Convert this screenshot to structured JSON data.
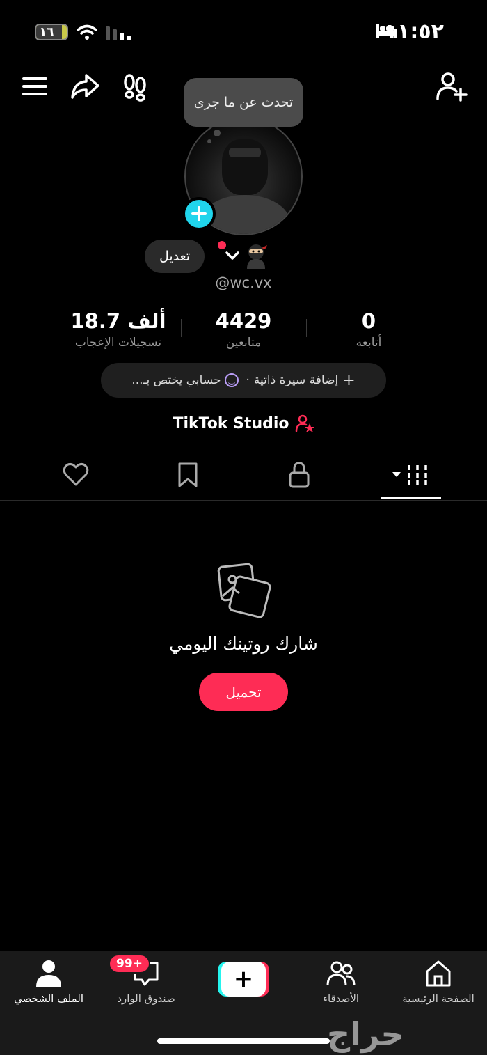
{
  "status_bar": {
    "time": "١١:٥٢",
    "battery_text": "١٦",
    "battery_level": 0.16
  },
  "bubble_text": "تحدث عن ما جرى",
  "profile": {
    "edit_label": "تعديل",
    "handle": "@wc.vx"
  },
  "stats": {
    "likes": {
      "value": "18.7 ألف",
      "label": "تسجيلات الإعجاب"
    },
    "followers": {
      "value": "4429",
      "label": "متابعين"
    },
    "following": {
      "value": "0",
      "label": "أتابعه"
    }
  },
  "bio": {
    "add_label": "إضافة سيرة ذاتية",
    "separator": "·",
    "prompt": "حسابي يختص بـ..."
  },
  "studio_label": "TikTok Studio",
  "empty_state": {
    "title": "شارك روتينك اليومي",
    "button": "تحميل"
  },
  "bottom_nav": {
    "home": "الصفحة الرئيسية",
    "friends": "الأصدقاء",
    "create": "+",
    "inbox": "صندوق الوارد",
    "inbox_badge": "99+",
    "profile": "الملف الشخصي"
  },
  "watermark": "حراج",
  "colors": {
    "accent": "#fe2c55",
    "cyan": "#20d5ec",
    "background": "#000000"
  }
}
